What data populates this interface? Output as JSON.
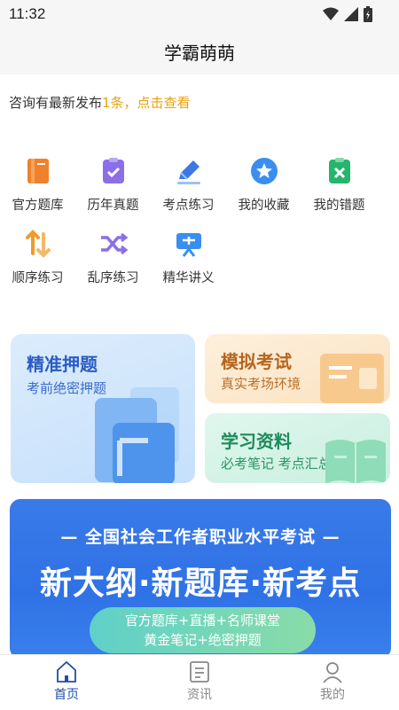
{
  "status_bar": {
    "time": "11:32"
  },
  "header": {
    "title": "学霸萌萌"
  },
  "notice": {
    "prefix": "咨询有最新发布",
    "highlight": "1条，点击查看"
  },
  "menu": [
    {
      "label": "官方题库",
      "icon": "book-icon"
    },
    {
      "label": "历年真题",
      "icon": "clipboard-check-icon"
    },
    {
      "label": "考点练习",
      "icon": "edit-pen-icon"
    },
    {
      "label": "我的收藏",
      "icon": "star-icon"
    },
    {
      "label": "我的错题",
      "icon": "wrong-x-icon"
    },
    {
      "label": "顺序练习",
      "icon": "sort-arrows-icon"
    },
    {
      "label": "乱序练习",
      "icon": "shuffle-icon"
    },
    {
      "label": "精华讲义",
      "icon": "lecture-icon"
    }
  ],
  "cards": {
    "prediction": {
      "title": "精准押题",
      "subtitle": "考前绝密押题"
    },
    "mock": {
      "title": "模拟考试",
      "subtitle": "真实考场环境"
    },
    "materials": {
      "title": "学习资料",
      "subtitle": "必考笔记 考点汇总"
    }
  },
  "banner": {
    "line1": "— 全国社会工作者职业水平考试 —",
    "line2": "新大纲·新题库·新考点",
    "pill_line1": "官方题库+直播+名师课堂",
    "pill_line2": "黄金笔记+绝密押题"
  },
  "tabs": [
    {
      "label": "首页",
      "active": true
    },
    {
      "label": "资讯",
      "active": false
    },
    {
      "label": "我的",
      "active": false
    }
  ],
  "colors": {
    "accent": "#e8a20e",
    "primary": "#2f6fd6",
    "tab_active": "#1f4fa8",
    "tab_inactive": "#888888"
  }
}
